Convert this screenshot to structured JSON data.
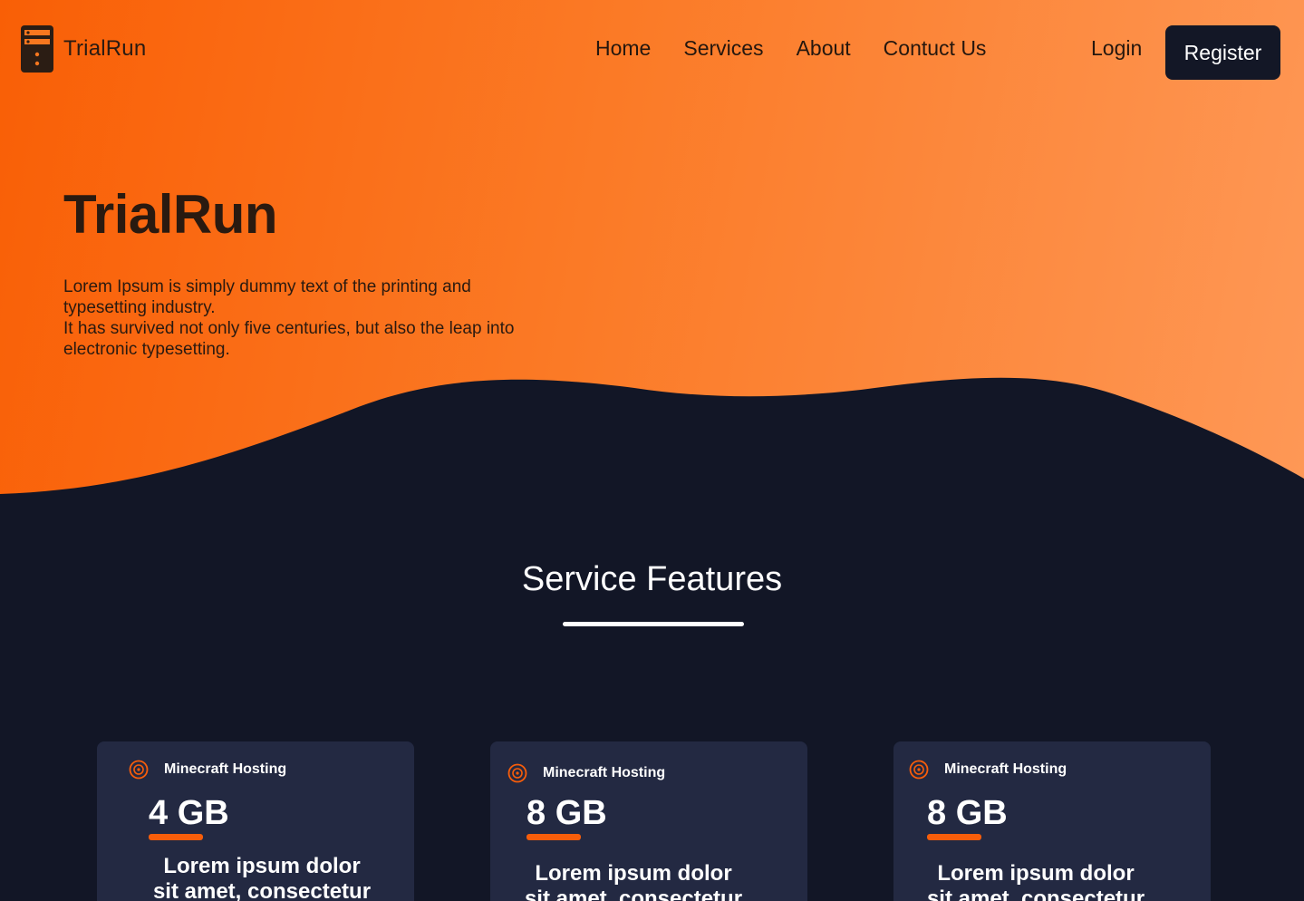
{
  "brand": {
    "name": "TrialRun"
  },
  "nav": {
    "items": [
      "Home",
      "Services",
      "About",
      "Contuct Us"
    ]
  },
  "auth": {
    "login_label": "Login",
    "register_label": "Register"
  },
  "hero": {
    "title": "TrialRun",
    "description_lines": [
      "Lorem Ipsum is simply dummy text of the printing and typesetting industry.",
      "It has survived not only five centuries, but also the leap into electronic typesetting."
    ]
  },
  "features": {
    "title": "Service Features",
    "cards": [
      {
        "label": "Minecraft Hosting",
        "size": "4 GB",
        "text": "Lorem ipsum dolor sit amet, consectetur"
      },
      {
        "label": "Minecraft Hosting",
        "size": "8 GB",
        "text": "Lorem ipsum dolor sit amet, consectetur"
      },
      {
        "label": "Minecraft Hosting",
        "size": "8 GB",
        "text": "Lorem ipsum dolor sit amet, consectetur"
      }
    ]
  },
  "colors": {
    "accent": "#f75d0a",
    "gradient_start": "#f95f06",
    "gradient_end": "#fe9856",
    "dark_bg": "#121626",
    "card_bg": "#232942"
  },
  "icons": {
    "logo": "server-icon",
    "card": "target-icon"
  }
}
